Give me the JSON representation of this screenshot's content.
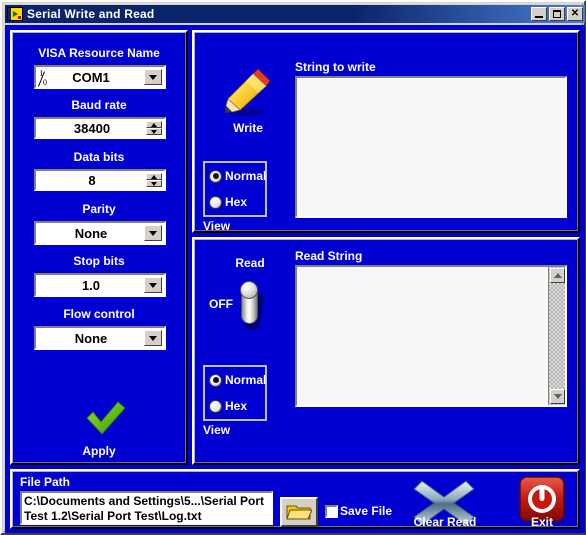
{
  "window": {
    "title": "Serial Write and Read",
    "icon": "labview-vi-icon",
    "controls": {
      "minimize": "minimize-button",
      "maximize": "maximize-button",
      "close": "close-button"
    }
  },
  "theme": {
    "panel_background": "#0000d0",
    "title_bar_start": "#0a246a",
    "title_bar_end": "#4a7fd0",
    "control_face": "#d4d0c8",
    "field_background": "#ffffff",
    "label_color": "#ffffff",
    "apply_check_color": "#6abf1e",
    "exit_button_color": "#c00000",
    "clear_read_color": "#9fb6cc"
  },
  "config_panel": {
    "visa": {
      "label": "VISA Resource Name",
      "value": "COM1",
      "glyph_top": "I",
      "glyph_bottom": "0",
      "type": "combo"
    },
    "baud": {
      "label": "Baud rate",
      "value": "38400",
      "type": "numeric"
    },
    "data_bits": {
      "label": "Data bits",
      "value": "8",
      "type": "numeric"
    },
    "parity": {
      "label": "Parity",
      "value": "None",
      "type": "combo"
    },
    "stop_bits": {
      "label": "Stop bits",
      "value": "1.0",
      "type": "combo"
    },
    "flow_control": {
      "label": "Flow control",
      "value": "None",
      "type": "combo"
    },
    "apply": {
      "label": "Apply",
      "icon": "green-check-icon"
    }
  },
  "write_panel": {
    "button_label": "Write",
    "button_icon": "pencil-icon",
    "string_label": "String to write",
    "string_value": "",
    "view_label": "View",
    "view_options": [
      {
        "label": "Normal",
        "selected": true
      },
      {
        "label": "Hex",
        "selected": false
      }
    ]
  },
  "read_panel": {
    "button_label": "Read",
    "switch_state": "OFF",
    "string_label": "Read String",
    "string_value": "",
    "view_label": "View",
    "view_options": [
      {
        "label": "Normal",
        "selected": true
      },
      {
        "label": "Hex",
        "selected": false
      }
    ]
  },
  "file_panel": {
    "path_label": "File Path",
    "path_value": "C:\\Documents and Settings\\5...\\Serial Port Test 1.2\\Serial Port Test\\Log.txt",
    "browse_icon": "folder-icon",
    "save_file": {
      "label": "Save File",
      "checked": false
    },
    "clear_read": {
      "label": "Clear Read",
      "icon": "x-cross-icon"
    },
    "exit": {
      "label": "Exit",
      "icon": "power-icon"
    }
  }
}
